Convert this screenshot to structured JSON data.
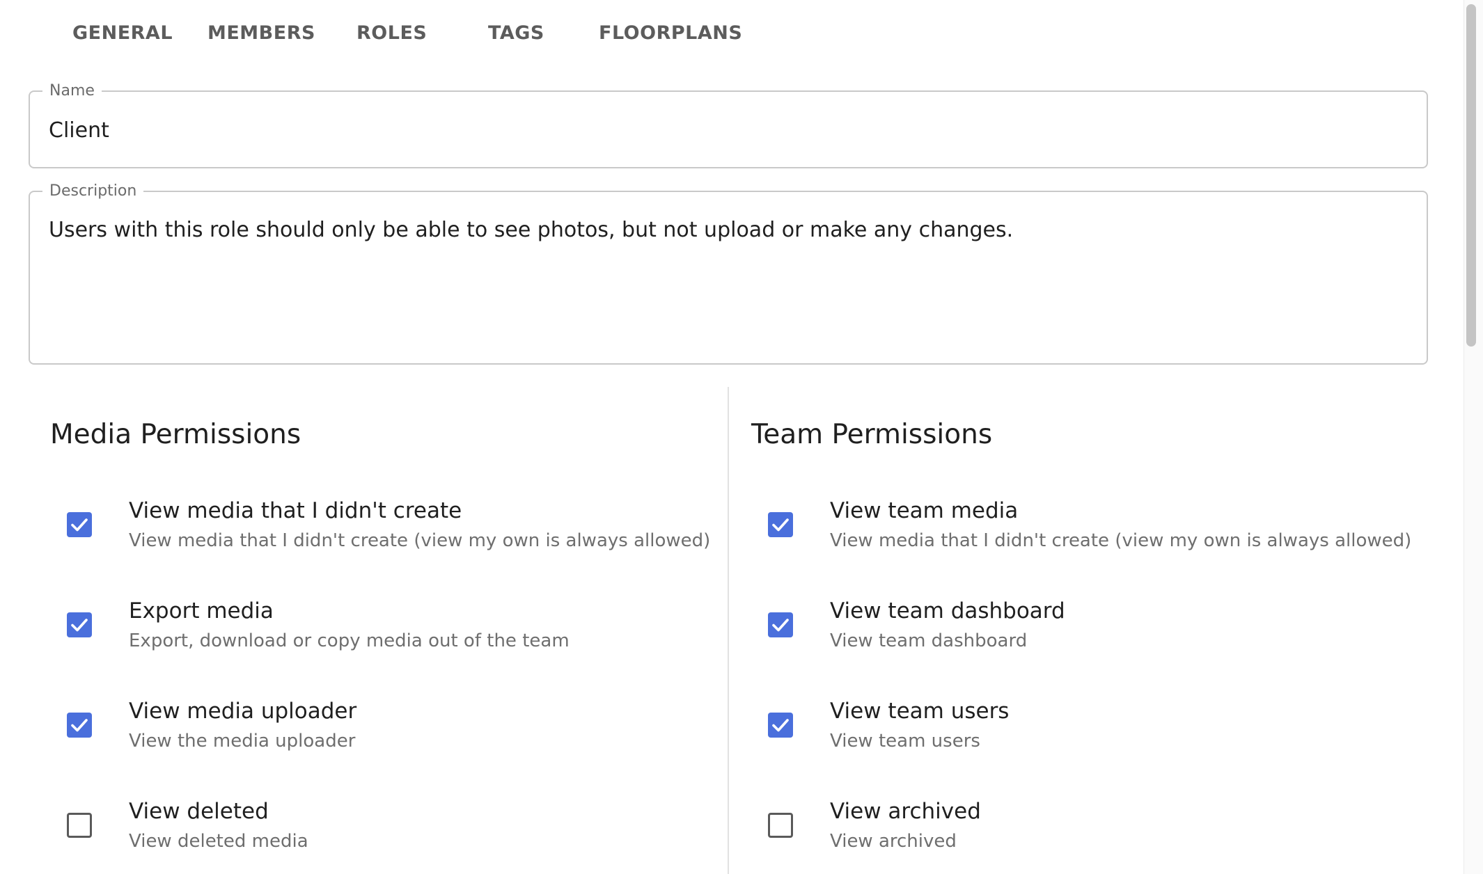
{
  "tabs": [
    {
      "label": "GENERAL"
    },
    {
      "label": "MEMBERS"
    },
    {
      "label": "ROLES"
    },
    {
      "label": "TAGS"
    },
    {
      "label": "FLOORPLANS"
    }
  ],
  "name_field": {
    "label": "Name",
    "value": "Client"
  },
  "description_field": {
    "label": "Description",
    "value": "Users with this role should only be able to see photos, but not upload or make any changes."
  },
  "media_permissions": {
    "title": "Media Permissions",
    "items": [
      {
        "title": "View media that I didn't create",
        "description": "View media that I didn't create (view my own is always allowed)",
        "checked": true
      },
      {
        "title": "Export media",
        "description": "Export, download or copy media out of the team",
        "checked": true
      },
      {
        "title": "View media uploader",
        "description": "View the media uploader",
        "checked": true
      },
      {
        "title": "View deleted",
        "description": "View deleted media",
        "checked": false
      }
    ]
  },
  "team_permissions": {
    "title": "Team Permissions",
    "items": [
      {
        "title": "View team media",
        "description": "View media that I didn't create (view my own is always allowed)",
        "checked": true
      },
      {
        "title": "View team dashboard",
        "description": "View team dashboard",
        "checked": true
      },
      {
        "title": "View team users",
        "description": "View team users",
        "checked": true
      },
      {
        "title": "View archived",
        "description": "View archived",
        "checked": false
      }
    ]
  },
  "colors": {
    "accent": "#4a6fdc",
    "tab_text": "#5c5c5c",
    "border": "#c9c9c9",
    "secondary_text": "#6e6e6e"
  },
  "icons": {
    "checked": "check-icon",
    "unchecked": "empty-box-icon"
  }
}
